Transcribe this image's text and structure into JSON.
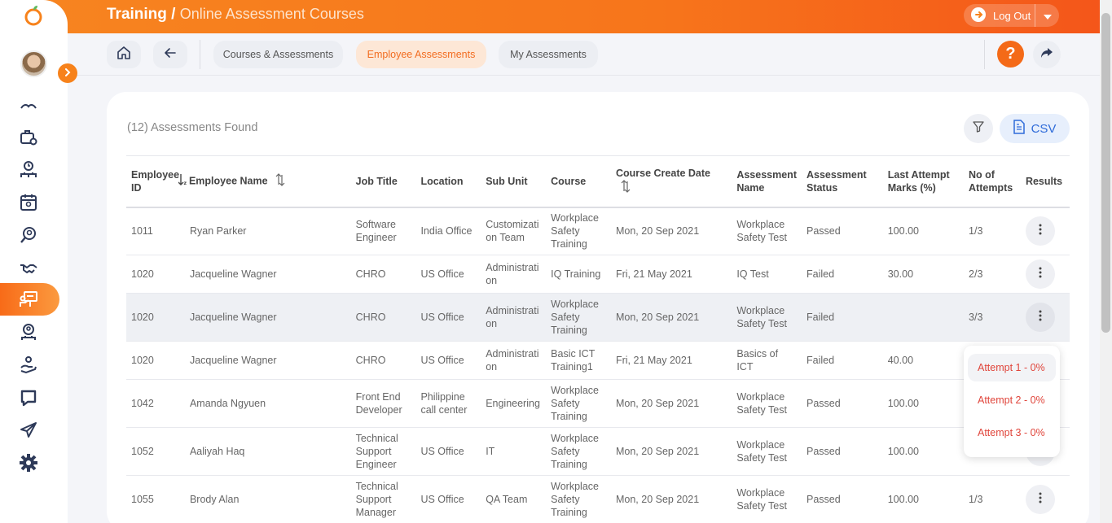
{
  "header": {
    "title_main": "Training",
    "title_sep": " / ",
    "title_sub": "Online Assessment Courses",
    "logout_label": "Log Out"
  },
  "subnav": {
    "tabs": [
      {
        "label": "Courses & Assessments",
        "active": false
      },
      {
        "label": "Employee Assessments",
        "active": true
      },
      {
        "label": "My Assessments",
        "active": false
      }
    ],
    "help_label": "?"
  },
  "content": {
    "found_label": "(12) Assessments Found",
    "csv_label": "CSV"
  },
  "table": {
    "headers": [
      "Employee ID",
      "Employee Name",
      "Job Title",
      "Location",
      "Sub Unit",
      "Course",
      "Course Create Date",
      "Assessment Name",
      "Assessment Status",
      "Last Attempt Marks (%)",
      "No of Attempts",
      "Results"
    ],
    "rows": [
      [
        "1011",
        "Ryan Parker",
        "Software Engineer",
        "India Office",
        "Customization Team",
        "Workplace Safety Training",
        "Mon, 20 Sep 2021",
        "Workplace Safety Test",
        "Passed",
        "100.00",
        "1/3"
      ],
      [
        "1020",
        "Jacqueline Wagner",
        "CHRO",
        "US Office",
        "Administration",
        "IQ Training",
        "Fri, 21 May 2021",
        "IQ Test",
        "Failed",
        "30.00",
        "2/3"
      ],
      [
        "1020",
        "Jacqueline Wagner",
        "CHRO",
        "US Office",
        "Administration",
        "Workplace Safety Training",
        "Mon, 20 Sep 2021",
        "Workplace Safety Test",
        "Failed",
        "",
        "3/3"
      ],
      [
        "1020",
        "Jacqueline Wagner",
        "CHRO",
        "US Office",
        "Administration",
        "Basic ICT Training1",
        "Fri, 21 May 2021",
        "Basics of ICT",
        "Failed",
        "40.00",
        ""
      ],
      [
        "1042",
        "Amanda Ngyuen",
        "Front End Developer",
        "Philippine call center",
        "Engineering",
        "Workplace Safety Training",
        "Mon, 20 Sep 2021",
        "Workplace Safety Test",
        "Passed",
        "100.00",
        ""
      ],
      [
        "1052",
        "Aaliyah Haq",
        "Technical Support Engineer",
        "US Office",
        "IT",
        "Workplace Safety Training",
        "Mon, 20 Sep 2021",
        "Workplace Safety Test",
        "Passed",
        "100.00",
        ""
      ],
      [
        "1055",
        "Brody Alan",
        "Technical Support Manager",
        "US Office",
        "QA Team",
        "Workplace Safety Training",
        "Mon, 20 Sep 2021",
        "Workplace Safety Test",
        "Passed",
        "100.00",
        "1/3"
      ]
    ]
  },
  "dropdown": {
    "items": [
      "Attempt 1 - 0%",
      "Attempt 2 - 0%",
      "Attempt 3 - 0%"
    ]
  },
  "colors": {
    "brand_orange": "#f7821b",
    "active_tab_bg": "#fde7d6",
    "csv_blue": "#2f6bd9",
    "attempt_red": "#e0453b"
  }
}
